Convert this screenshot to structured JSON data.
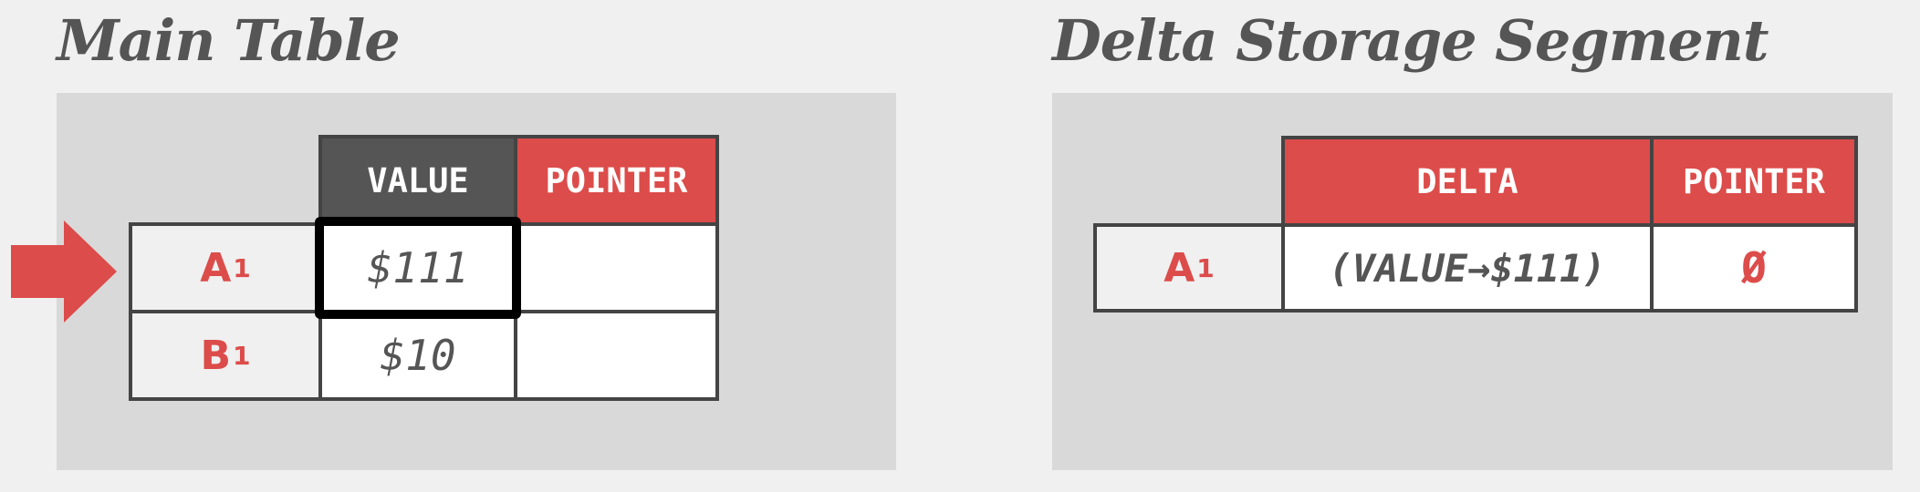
{
  "main_table": {
    "title": "Main Table",
    "headers": {
      "value": "VALUE",
      "pointer": "POINTER"
    },
    "rows": [
      {
        "key": "A",
        "key_sub": "1",
        "value": "$111",
        "pointer": ""
      },
      {
        "key": "B",
        "key_sub": "1",
        "value": "$10",
        "pointer": ""
      }
    ],
    "highlighted_row": 0
  },
  "delta_storage": {
    "title": "Delta Storage Segment",
    "headers": {
      "delta": "DELTA",
      "pointer": "POINTER"
    },
    "rows": [
      {
        "key": "A",
        "key_sub": "1",
        "delta": "(VALUE→$111)",
        "pointer": "Ø"
      }
    ]
  },
  "colors": {
    "accent_red": "#dc4c4a",
    "header_dark": "#555555",
    "border": "#444444",
    "panel_bg": "#d9d9d9",
    "page_bg": "#f0f0f0"
  },
  "icons": [
    "right-arrow-icon"
  ]
}
